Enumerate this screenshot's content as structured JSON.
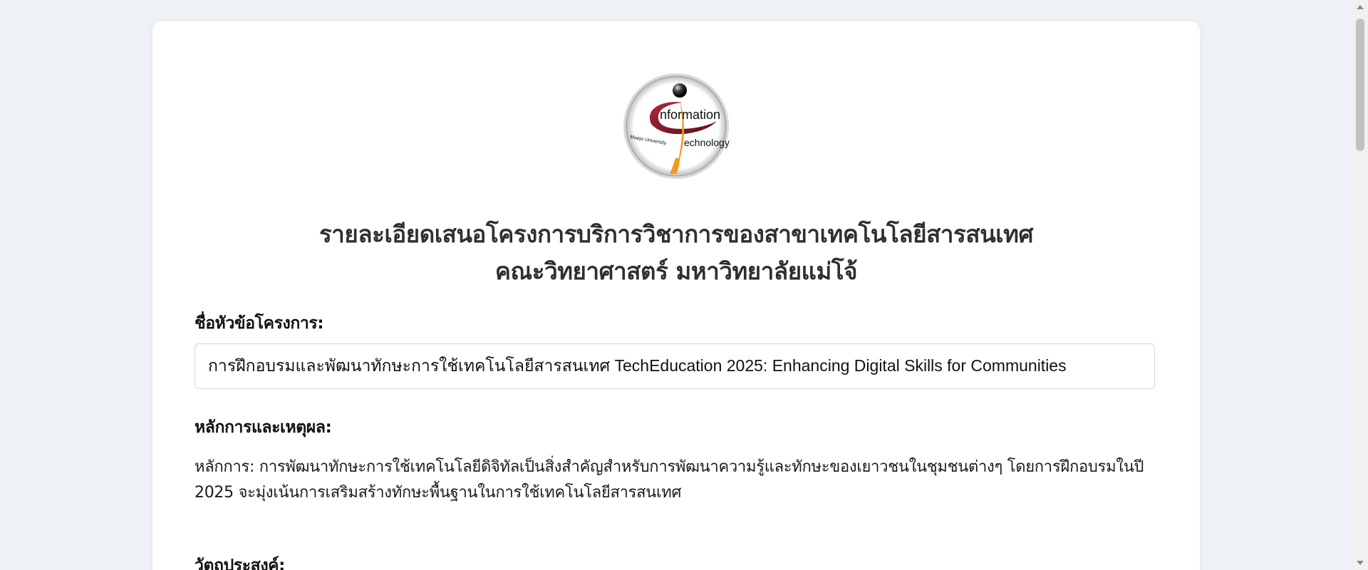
{
  "logo": {
    "icon": "it-department-logo",
    "text_line1": "nformation",
    "text_line2": "echnology",
    "text_small": "Maejo University"
  },
  "title": {
    "line1": "รายละเอียดเสนอโครงการบริการวิชาการของสาขาเทคโนโลยีสารสนเทศ",
    "line2": "คณะวิทยาศาสตร์ มหาวิทยาลัยแม่โจ้"
  },
  "project": {
    "label": "ชื่อหัวข้อโครงการ:",
    "value": "การฝึกอบรมและพัฒนาทักษะการใช้เทคโนโลยีสารสนเทศ TechEducation 2025: Enhancing Digital Skills for Communities"
  },
  "rationale": {
    "label": "หลักการและเหตุผล:",
    "text": "หลักการ: การพัฒนาทักษะการใช้เทคโนโลยีดิจิทัลเป็นสิ่งสำคัญสำหรับการพัฒนาความรู้และทักษะของเยาวชนในชุมชนต่างๆ โดยการฝึกอบรมในปี 2025 จะมุ่งเน้นการเสริมสร้างทักษะพื้นฐานในการใช้เทคโนโลยีสารสนเทศ"
  },
  "objectives": {
    "label": "วัตถุประสงค์:"
  },
  "colors": {
    "background": "#eef1f5",
    "card": "#ffffff",
    "logo_maroon": "#8b1c2b",
    "logo_orange": "#f39a1e",
    "heading": "#2f2f2f"
  }
}
